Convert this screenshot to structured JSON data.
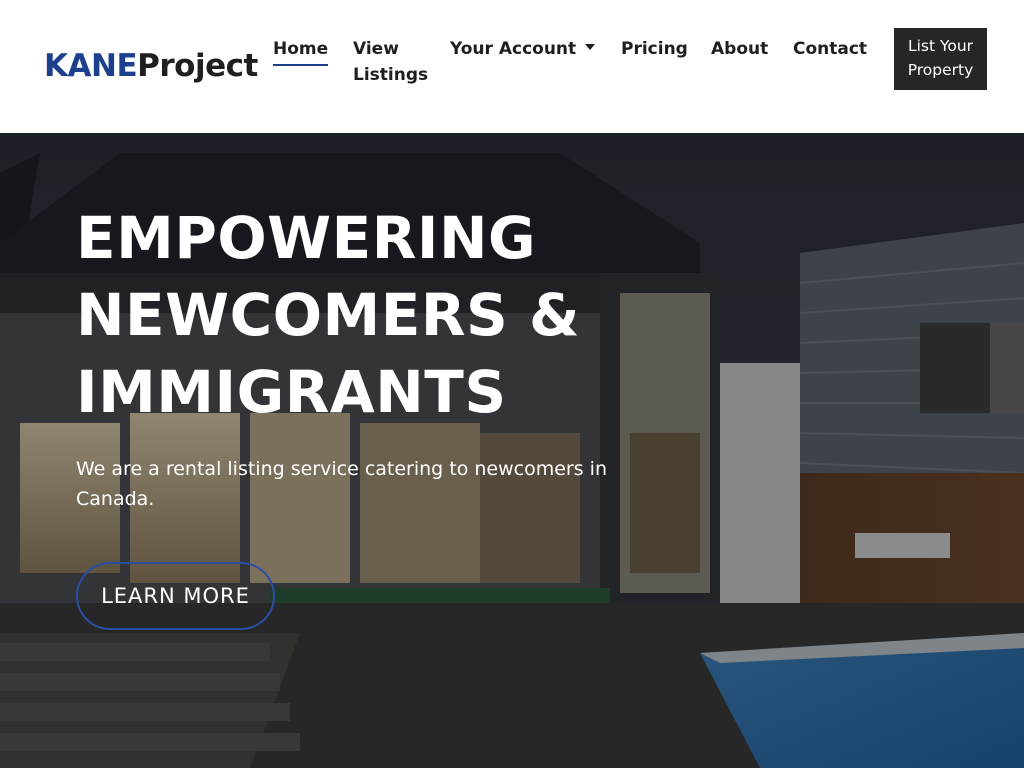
{
  "logo": {
    "part1": "KANE",
    "part2": "Project"
  },
  "nav": {
    "home": "Home",
    "view_listings_line1": "View",
    "view_listings_line2": "Listings",
    "your_account": "Your Account",
    "pricing": "Pricing",
    "about": "About",
    "contact": "Contact"
  },
  "cta": {
    "line1": "List Your",
    "line2": "Property"
  },
  "hero": {
    "title_line1": "EMPOWERING",
    "title_line2": "NEWCOMERS &",
    "title_line3": "IMMIGRANTS",
    "text": "We are a rental listing service catering to newcomers in Canada.",
    "button": "LEARN MORE"
  },
  "icons": {
    "dropdown": "chevron-down-icon"
  },
  "colors": {
    "brand": "#1c3f8e",
    "nav_text": "#1f1f1f",
    "cta_bg": "#262626",
    "button_border": "#2b4ea5"
  }
}
